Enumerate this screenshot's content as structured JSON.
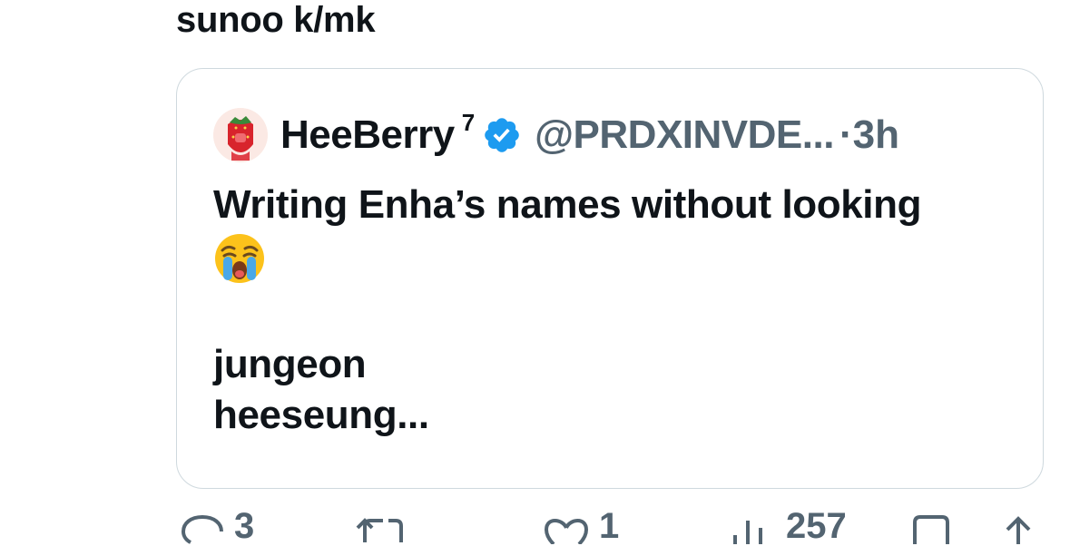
{
  "tweet": {
    "text": "sunoo k/mk"
  },
  "quote": {
    "author_name": "HeeBerry",
    "author_badge": "7",
    "verified_color": "#1d9bf0",
    "handle": "@PRDXINVDE...",
    "time_separator": "·",
    "time": "3h",
    "line1": "Writing Enha’s names without looking",
    "emoji": "loudly-crying-face",
    "line2": "jungeon",
    "line3": "heeseung..."
  },
  "actions": {
    "reply_count": "3",
    "like_count": "1",
    "views_count": "257"
  }
}
